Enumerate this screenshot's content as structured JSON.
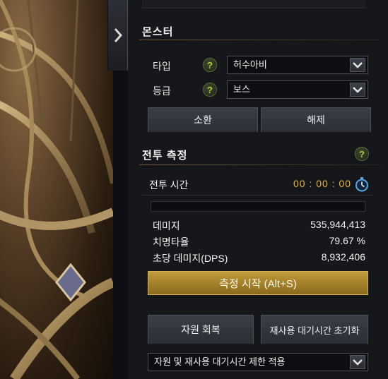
{
  "panel": {
    "monster_section": {
      "title": "몬스터",
      "type_label": "타입",
      "type_value": "허수아비",
      "grade_label": "등급",
      "grade_value": "보스",
      "summon_label": "소환",
      "release_label": "해제"
    },
    "combat_section": {
      "title": "전투 측정",
      "timer_label": "전투 시간",
      "timer_value": "00 : 00 : 00",
      "progress": 0,
      "stats": [
        {
          "label": "데미지",
          "value": "535,944,413"
        },
        {
          "label": "치명타율",
          "value": "79.67 %"
        },
        {
          "label": "초당 데미지(DPS)",
          "value": "8,932,406"
        }
      ],
      "start_label": "측정 시작 (Alt+S)"
    },
    "resource_recover_label": "자원 회복",
    "cooldown_reset_label": "재사용 대기시간 초기화",
    "limit_select_value": "자원 및 재사용 대기시간 제한 적용"
  },
  "icons": {
    "help": "?",
    "collapse": "chevron-right-icon",
    "stopwatch": "stopwatch-icon",
    "dropdown": "chevron-down-icon"
  },
  "colors": {
    "accent_gold": "#c09a3a",
    "timer": "#e9b53a",
    "help_green": "#a8d040"
  }
}
